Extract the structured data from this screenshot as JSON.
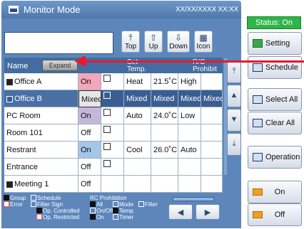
{
  "window": {
    "title": "Monitor Mode",
    "datetime": "XX/XX/XXXX  XX:XX"
  },
  "status": "Status: On",
  "nav": [
    {
      "glyph": "⤒",
      "label": "Top"
    },
    {
      "glyph": "⇧",
      "label": "Up"
    },
    {
      "glyph": "⇩",
      "label": "Down"
    },
    {
      "glyph": "▦",
      "label": "Icon"
    }
  ],
  "table": {
    "header_name": "Name",
    "expand_label": "Expand",
    "header_cols": [
      "",
      "",
      "Set Temp.",
      "",
      "R/C Prohibit"
    ],
    "rows": [
      {
        "name": "Office A",
        "onoff": "On",
        "mode": "Heat",
        "temp": "21.5˚C",
        "fan": "High",
        "prohibit": "",
        "group": true
      },
      {
        "name": "Office B",
        "onoff": "Mixed",
        "mode": "Mixed",
        "temp": "Mixed",
        "fan": "Mixed",
        "prohibit": "Mixed",
        "group": true,
        "selected": true
      },
      {
        "name": "PC Room",
        "onoff": "On",
        "mode": "Auto",
        "temp": "24.0˚C",
        "fan": "Low",
        "prohibit": ""
      },
      {
        "name": "Room 101",
        "onoff": "Off",
        "mode": "",
        "temp": "",
        "fan": "",
        "prohibit": ""
      },
      {
        "name": "Restrant",
        "onoff": "On",
        "mode": "Cool",
        "temp": "26.0˚C",
        "fan": "Auto",
        "prohibit": ""
      },
      {
        "name": "Entrance",
        "onoff": "Off",
        "mode": "",
        "temp": "",
        "fan": "",
        "prohibit": ""
      },
      {
        "name": "Meeting 1",
        "onoff": "Off",
        "mode": "",
        "temp": "",
        "fan": "",
        "prohibit": "",
        "group": true
      }
    ]
  },
  "legend": {
    "group": "Group",
    "error": "Error",
    "schedule": "Schedule",
    "filter_sign": "Filter Sign",
    "op_controlled": "Op. Controlled",
    "op_restricted": "Op. Restricted",
    "rc_prohibition": "RC Prohibition",
    "all": "All",
    "onoff": "On/Off",
    "on": "On",
    "mode": "Mode",
    "temp": "Temp.",
    "timer": "Timer",
    "filter": "Filter"
  },
  "side_buttons": {
    "setting": "Setting",
    "schedule": "Schedule",
    "select_all": "Select All",
    "clear_all": "Clear All",
    "operation": "Operation",
    "on": "On",
    "off": "Off"
  },
  "colors": {
    "panel": "#5d86bb",
    "status": "#2fb54a",
    "selected_row": "#3a5e92",
    "arrow": "#e8192c"
  }
}
